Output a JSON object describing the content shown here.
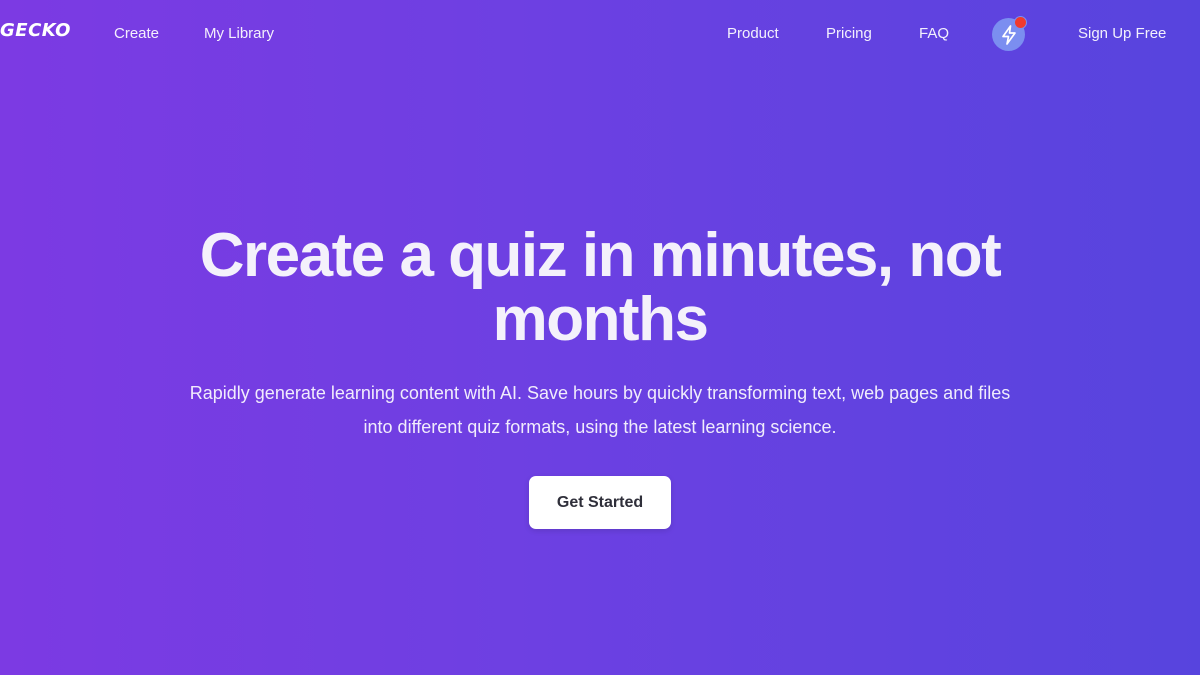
{
  "nav": {
    "logo": "GECKO",
    "left_links": [
      "Create",
      "My Library"
    ],
    "right_links": [
      "Product",
      "Pricing",
      "FAQ"
    ],
    "notification_icon": "lightning-bolt-icon",
    "signup_label": "Sign Up Free"
  },
  "hero": {
    "title": "Create a quiz in minutes, not months",
    "subtitle": "Rapidly generate learning content with AI. Save hours by quickly transforming text, web pages and files into different quiz formats, using the latest learning science.",
    "cta_label": "Get Started"
  },
  "colors": {
    "gradient_start": "#7c3ae3",
    "gradient_end": "#5744de",
    "notification_badge": "#f03a2e",
    "icon_circle": "#7b8ef0"
  }
}
